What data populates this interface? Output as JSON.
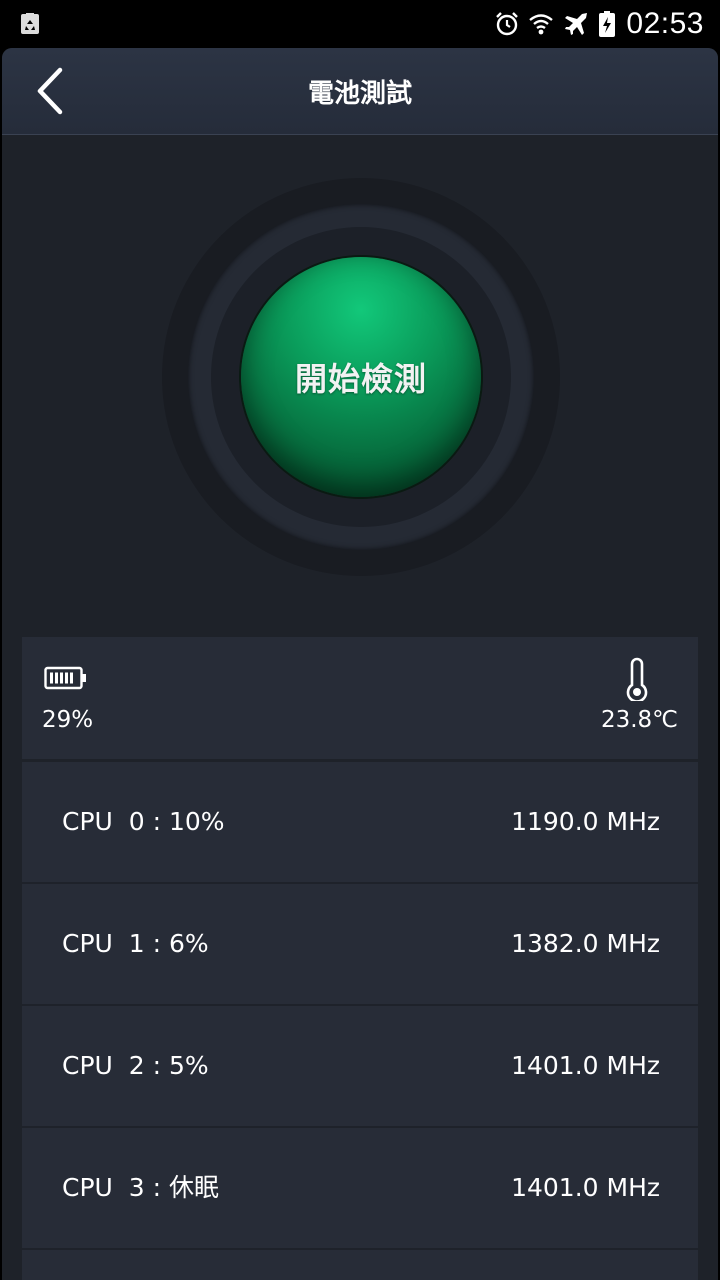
{
  "status_bar": {
    "time": "02:53",
    "icons": [
      "recycle-icon",
      "alarm-icon",
      "wifi-icon",
      "airplane-icon",
      "battery-charging-icon"
    ]
  },
  "header": {
    "title": "電池測試",
    "back_icon": "chevron-left-icon"
  },
  "start_button": {
    "label": "開始檢測",
    "color": "#0a9b5a"
  },
  "info": {
    "battery_icon": "battery-icon",
    "battery_percent": "29%",
    "battery_level": 0.29,
    "thermometer_icon": "thermometer-icon",
    "temperature": "23.8℃"
  },
  "cpus": [
    {
      "label": "CPU  0 : 10%",
      "freq": "1190.0 MHz"
    },
    {
      "label": "CPU  1 : 6%",
      "freq": "1382.0 MHz"
    },
    {
      "label": "CPU  2 : 5%",
      "freq": "1401.0 MHz"
    },
    {
      "label": "CPU  3 : 休眠",
      "freq": "1401.0 MHz"
    }
  ],
  "colors": {
    "background": "#1e2229",
    "panel": "#272c37",
    "header": "#2c3444",
    "accent": "#0a9b5a"
  }
}
